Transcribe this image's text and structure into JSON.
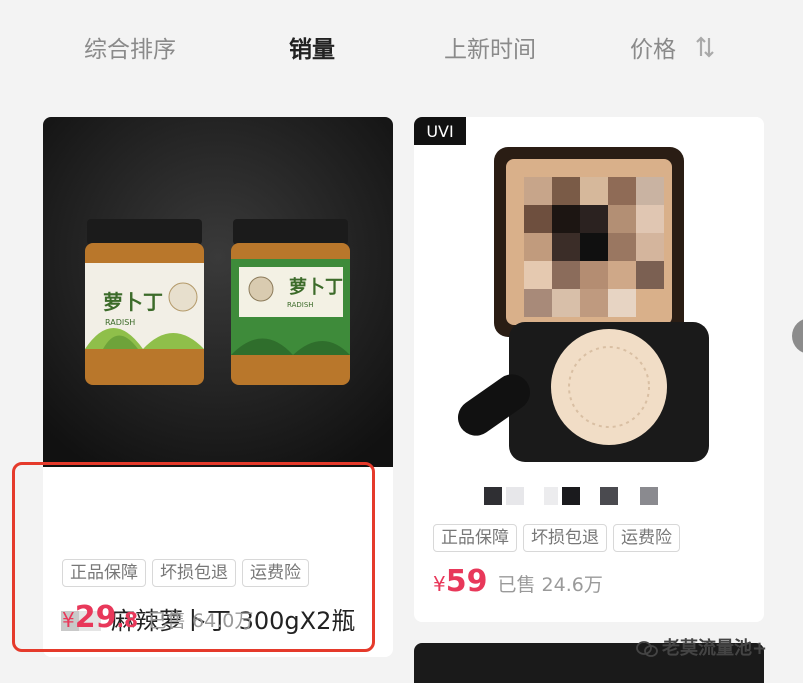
{
  "sort_bar": {
    "items": [
      "综合排序",
      "销量",
      "上新时间",
      "价格"
    ],
    "active": "销量"
  },
  "products": [
    {
      "title": "麻辣萝卜丁 300gX2瓶",
      "tags": [
        "正品保障",
        "坏损包退",
        "运费险"
      ],
      "currency": "¥",
      "price_int": "29",
      "price_dec": ".8",
      "sold": "已售 64.0万",
      "jar_label": "萝卜丁",
      "jar_sub": "RADISH"
    },
    {
      "brand_badge": "UVI",
      "tags": [
        "正品保障",
        "坏损包退",
        "运费险"
      ],
      "currency": "¥",
      "price_int": "59",
      "price_dec": "",
      "sold": "已售 24.6万"
    }
  ],
  "watermark": "老莫流量池+",
  "colors": {
    "price": "#e8385a",
    "highlight_border": "#e53a2b",
    "background": "#f3f3f3"
  }
}
